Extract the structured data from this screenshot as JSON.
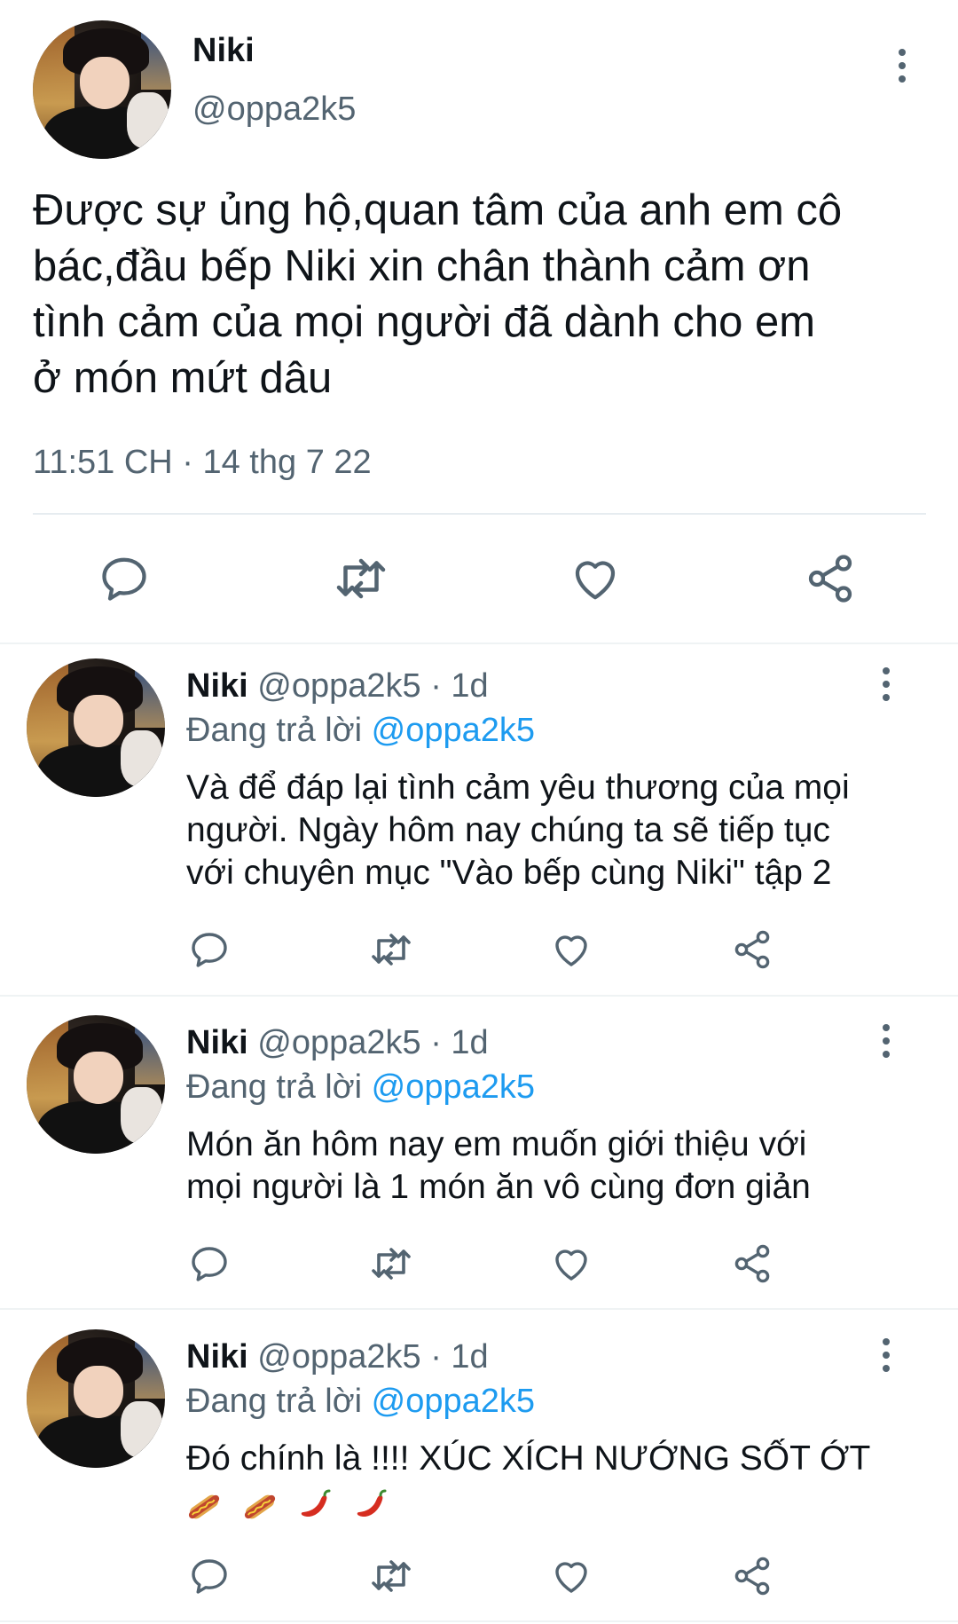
{
  "main_tweet": {
    "name": "Niki",
    "handle": "@oppa2k5",
    "text_lines": [
      "Được sự ủng hộ,quan tâm của anh em cô",
      "bác,đầu bếp Niki xin chân thành cảm ơn",
      "tình cảm của mọi người đã dành cho em",
      "ở món mứt dâu"
    ],
    "timestamp": "11:51 CH · 14 thg 7 22"
  },
  "replies": [
    {
      "name": "Niki",
      "handle_time": "@oppa2k5 · 1d",
      "replying_prefix": "Đang trả lời",
      "replying_to": "@oppa2k5",
      "text_lines": [
        "Và để đáp lại tình cảm yêu thương của mọi",
        "người. Ngày hôm nay chúng ta sẽ tiếp tục",
        "với chuyên mục \"Vào bếp cùng Niki\" tập 2"
      ]
    },
    {
      "name": "Niki",
      "handle_time": "@oppa2k5 · 1d",
      "replying_prefix": "Đang trả lời",
      "replying_to": "@oppa2k5",
      "text_lines": [
        "Món ăn hôm nay em muốn giới thiệu với",
        "mọi người là 1 món ăn vô cùng đơn giản"
      ]
    },
    {
      "name": "Niki",
      "handle_time": "@oppa2k5 · 1d",
      "replying_prefix": "Đang trả lời",
      "replying_to": "@oppa2k5",
      "text_lines": [
        "Đó chính là !!!! XÚC XÍCH NƯỚNG SỐT ỚT"
      ],
      "emojis": [
        "hotdog",
        "hotdog",
        "chili-pepper",
        "chili-pepper"
      ]
    }
  ],
  "icons": {
    "reply": "reply-icon",
    "retweet": "retweet-icon",
    "like": "like-icon",
    "share": "share-icon",
    "more": "more-vertical-icon"
  },
  "colors": {
    "text": "#0f1419",
    "muted": "#536471",
    "link": "#1d9bf0",
    "divider": "#eff3f4",
    "icon": "#536471"
  }
}
